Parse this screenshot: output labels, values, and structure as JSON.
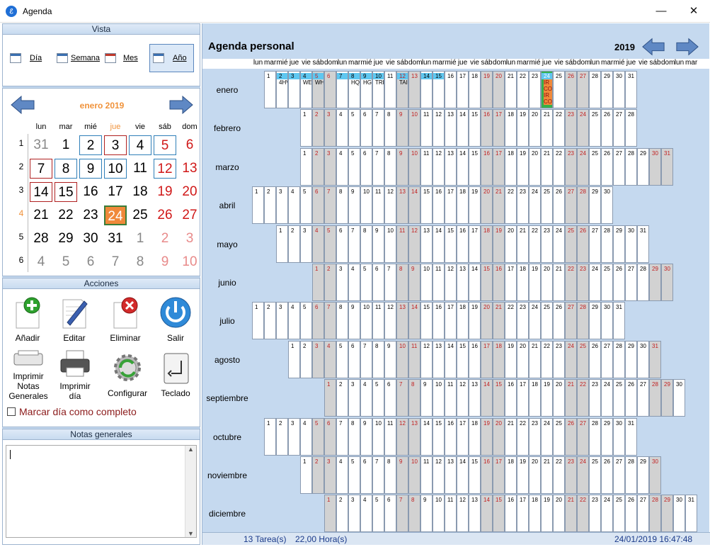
{
  "window": {
    "title": "Agenda",
    "minimize": "—",
    "close": "✕"
  },
  "vista": {
    "header": "Vista",
    "buttons": [
      {
        "label": "Día"
      },
      {
        "label": "Semana"
      },
      {
        "label": "Mes"
      },
      {
        "label": "Año",
        "selected": true
      }
    ]
  },
  "minical": {
    "title": "enero 2019",
    "day_headers": [
      "lun",
      "mar",
      "mié",
      "jue",
      "vie",
      "sáb",
      "dom"
    ],
    "weeks": [
      {
        "num": "1",
        "days": [
          [
            "31",
            "other"
          ],
          [
            "1",
            ""
          ],
          [
            "2",
            "blue"
          ],
          [
            "3",
            "red"
          ],
          [
            "4",
            "blue"
          ],
          [
            "5",
            "blue"
          ],
          [
            "6",
            ""
          ]
        ]
      },
      {
        "num": "2",
        "days": [
          [
            "7",
            "red"
          ],
          [
            "8",
            "blue"
          ],
          [
            "9",
            "blue"
          ],
          [
            "10",
            "blue"
          ],
          [
            "11",
            ""
          ],
          [
            "12",
            "blue"
          ],
          [
            "13",
            ""
          ]
        ]
      },
      {
        "num": "3",
        "days": [
          [
            "14",
            "red"
          ],
          [
            "15",
            "red"
          ],
          [
            "16",
            ""
          ],
          [
            "17",
            ""
          ],
          [
            "18",
            ""
          ],
          [
            "19",
            ""
          ],
          [
            "20",
            ""
          ]
        ]
      },
      {
        "num": "4",
        "days": [
          [
            "21",
            ""
          ],
          [
            "22",
            ""
          ],
          [
            "23",
            ""
          ],
          [
            "24",
            "today"
          ],
          [
            "25",
            ""
          ],
          [
            "26",
            ""
          ],
          [
            "27",
            ""
          ]
        ]
      },
      {
        "num": "5",
        "days": [
          [
            "28",
            ""
          ],
          [
            "29",
            ""
          ],
          [
            "30",
            ""
          ],
          [
            "31",
            ""
          ],
          [
            "1",
            "other"
          ],
          [
            "2",
            "other"
          ],
          [
            "3",
            "other"
          ]
        ]
      },
      {
        "num": "6",
        "days": [
          [
            "4",
            "other"
          ],
          [
            "5",
            "other"
          ],
          [
            "6",
            "other"
          ],
          [
            "7",
            "other"
          ],
          [
            "8",
            "other"
          ],
          [
            "9",
            "other"
          ],
          [
            "10",
            "other"
          ]
        ]
      }
    ]
  },
  "acciones": {
    "header": "Acciones",
    "buttons": [
      "Añadir",
      "Editar",
      "Eliminar",
      "Salir",
      "Imprimir Notas Generales",
      "Imprimir día",
      "Configurar",
      "Teclado"
    ],
    "checkbox_label": "Marcar día como completo"
  },
  "notas": {
    "header": "Notas generales",
    "value": ""
  },
  "agenda": {
    "title": "Agenda personal",
    "year": "2019",
    "weekday_cycle": [
      "lun",
      "mar",
      "mié",
      "jue",
      "vie",
      "sáb",
      "dom"
    ],
    "months": [
      {
        "name": "enero",
        "offset": 1,
        "days": 31
      },
      {
        "name": "febrero",
        "offset": 4,
        "days": 28
      },
      {
        "name": "marzo",
        "offset": 4,
        "days": 31
      },
      {
        "name": "abril",
        "offset": 0,
        "days": 30
      },
      {
        "name": "mayo",
        "offset": 2,
        "days": 31
      },
      {
        "name": "junio",
        "offset": 5,
        "days": 30
      },
      {
        "name": "julio",
        "offset": 0,
        "days": 31
      },
      {
        "name": "agosto",
        "offset": 3,
        "days": 31
      },
      {
        "name": "septiembre",
        "offset": 6,
        "days": 30
      },
      {
        "name": "octubre",
        "offset": 1,
        "days": 31
      },
      {
        "name": "noviembre",
        "offset": 4,
        "days": 30
      },
      {
        "name": "diciembre",
        "offset": 6,
        "days": 31
      }
    ],
    "january_tasks": [
      {
        "day": 2,
        "text": "4HV"
      },
      {
        "day": 3,
        "text": ""
      },
      {
        "day": 4,
        "text": "WE"
      },
      {
        "day": 5,
        "text": "WH"
      },
      {
        "day": 7,
        "text": ""
      },
      {
        "day": 8,
        "text": "HQ"
      },
      {
        "day": 9,
        "text": "HG"
      },
      {
        "day": 10,
        "text": "TRE"
      },
      {
        "day": 12,
        "text": "TAI"
      },
      {
        "day": 14,
        "text": ""
      },
      {
        "day": 15,
        "text": ""
      }
    ],
    "today": {
      "month": 0,
      "day": 24,
      "lines": [
        "IR",
        "CO",
        "IR",
        "CO"
      ]
    }
  },
  "status": {
    "tasks": "13 Tarea(s)",
    "hours": "22,00 Hora(s)",
    "datetime": "24/01/2019  16:47:48"
  },
  "colors": {
    "accent": "#5fc7f0",
    "today": "#f0893a",
    "weekend": "#d2d2d2",
    "panel_bg": "#c5d9ef"
  }
}
